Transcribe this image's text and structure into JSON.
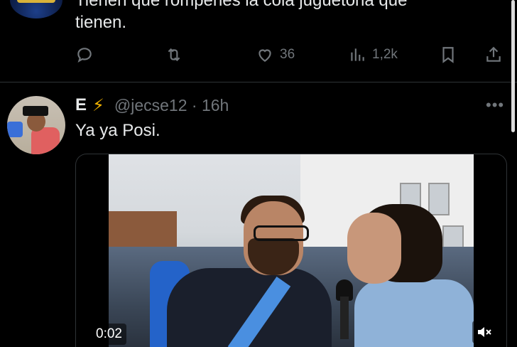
{
  "previous_tweet": {
    "text_line1": "Tienen que rompeñes la cola juguetona que",
    "text_line2": "tienen.",
    "actions": {
      "reply_count": "",
      "retweet_count": "",
      "like_count": "36",
      "view_count": "1,2k"
    }
  },
  "tweet": {
    "display_name": "E",
    "badge_emoji": "⚡",
    "handle_time": "@jecse12 · 16h",
    "more_label": "•••",
    "text": "Ya ya Posi.",
    "video": {
      "timer": "0:02",
      "muted": true
    }
  },
  "icons": [
    "reply-icon",
    "retweet-icon",
    "like-icon",
    "views-icon",
    "bookmark-icon",
    "share-icon",
    "more-icon",
    "mute-icon"
  ],
  "colors": {
    "background": "#000000",
    "text_primary": "#e7e9ea",
    "text_secondary": "#71767b",
    "divider": "#2f3336",
    "bolt": "#f4b400"
  }
}
